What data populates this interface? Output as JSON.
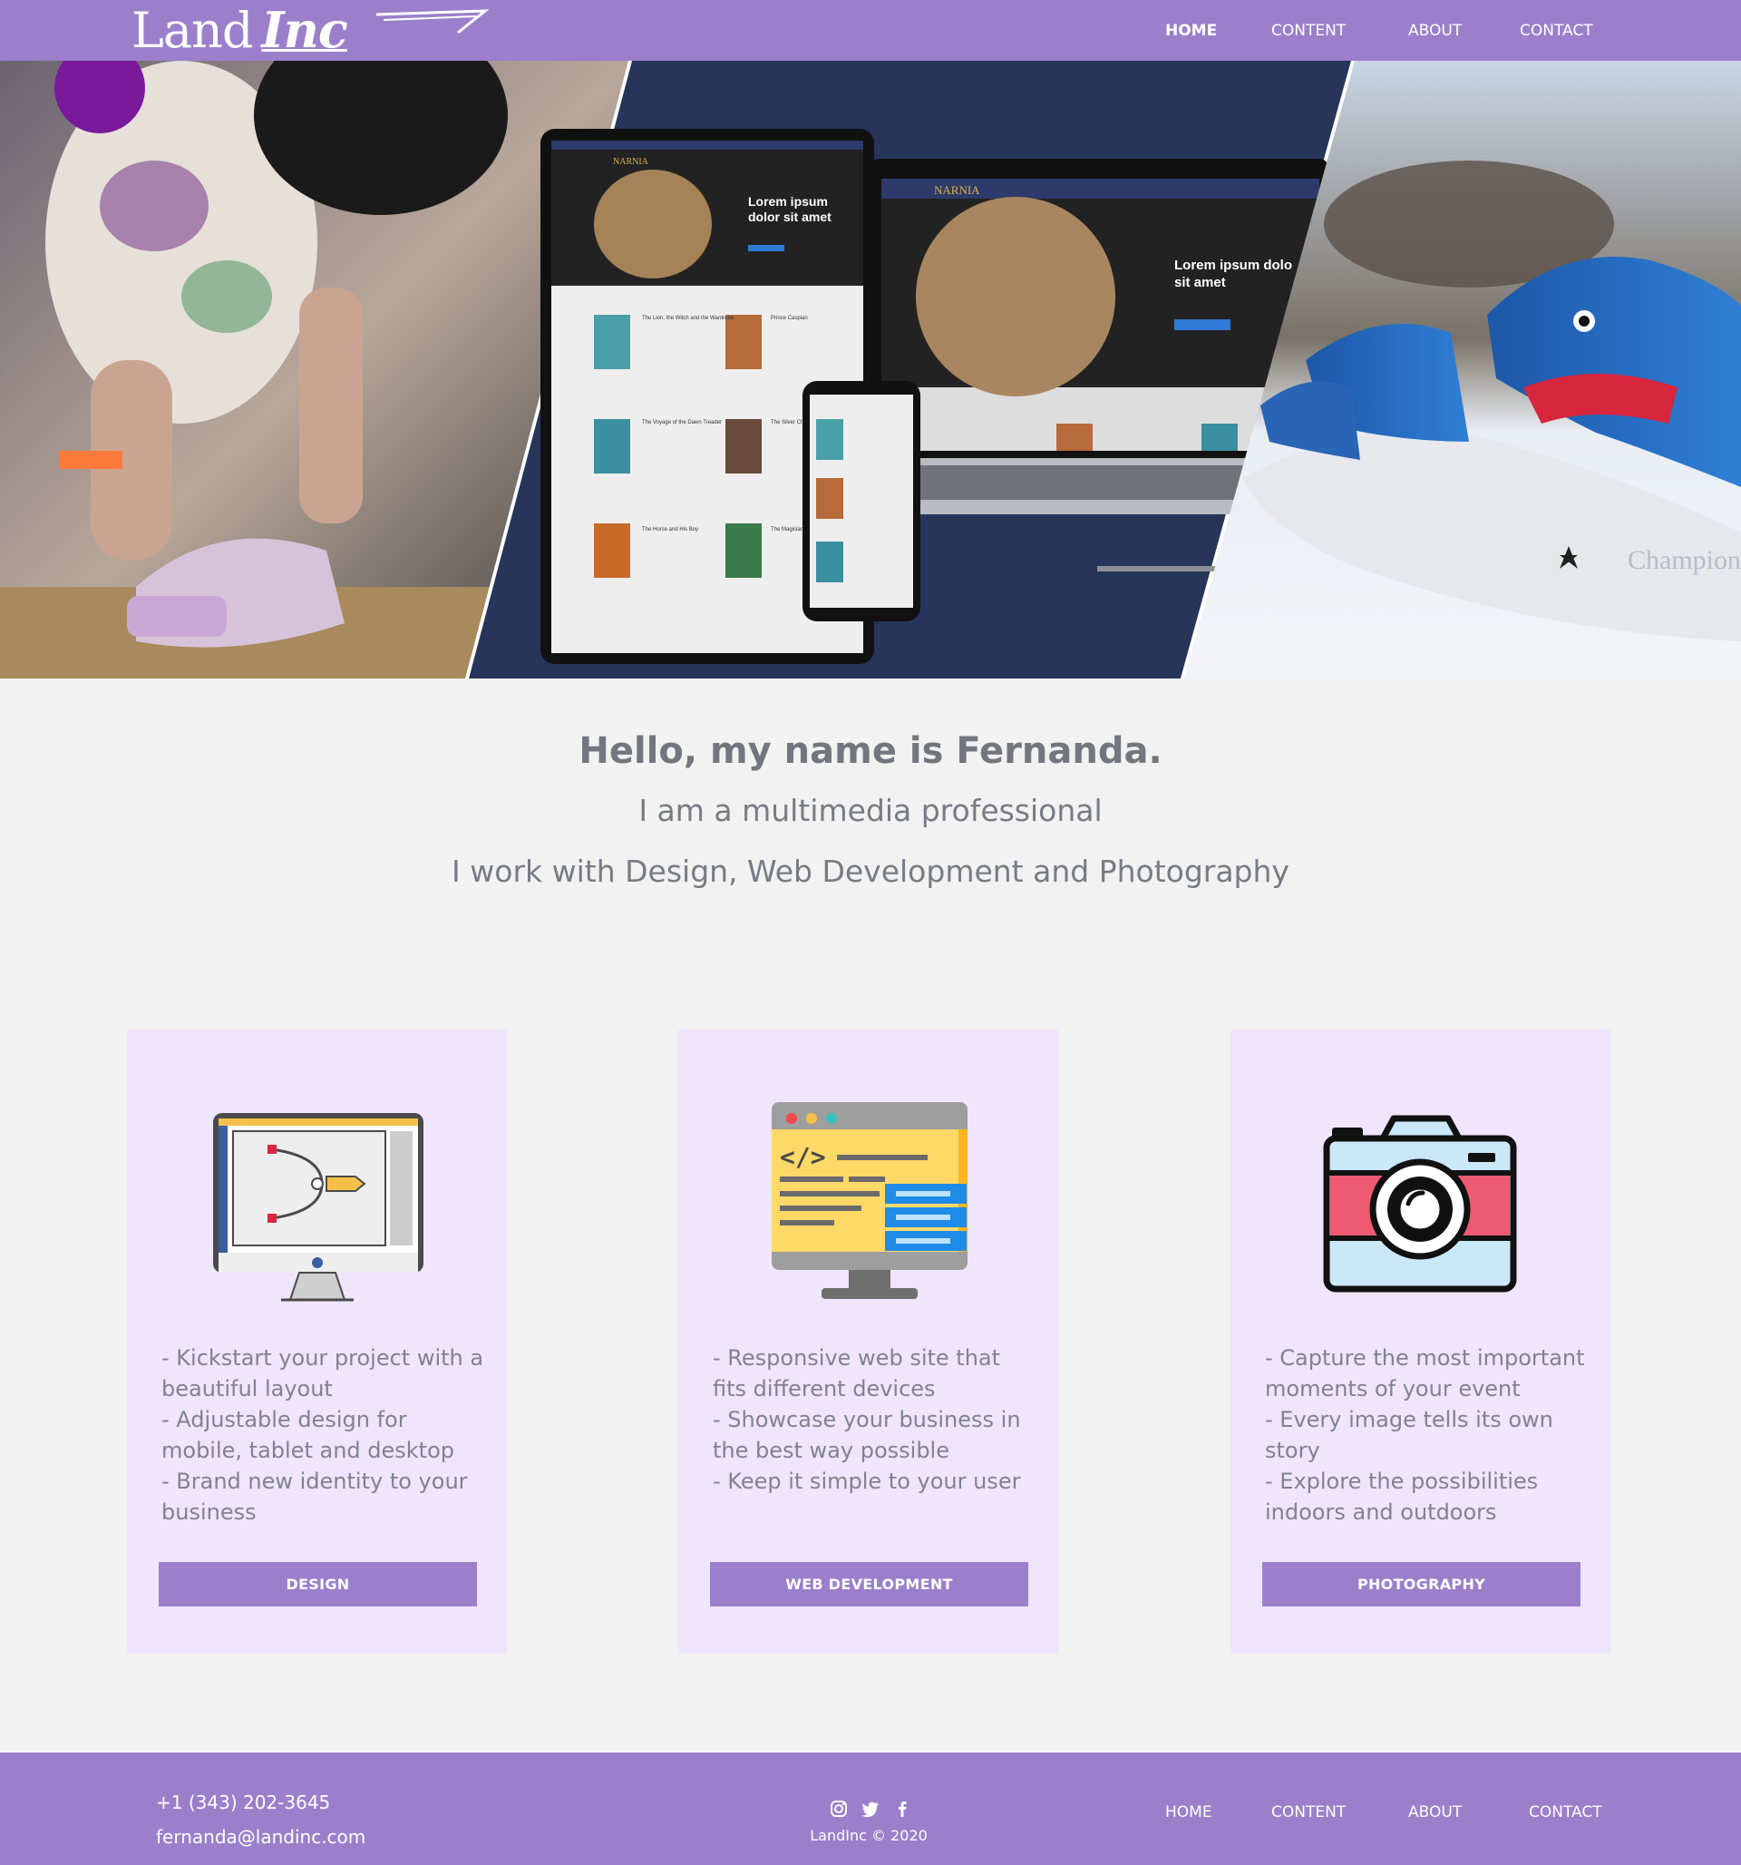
{
  "header": {
    "logo_part1": "Land",
    "logo_part2": "Inc",
    "nav": [
      {
        "label": "HOME",
        "active": true
      },
      {
        "label": "CONTENT",
        "active": false
      },
      {
        "label": "ABOUT",
        "active": false
      },
      {
        "label": "CONTACT",
        "active": false
      }
    ]
  },
  "hero": {
    "mockup_heading_line1": "Lorem ipsum",
    "mockup_heading_line2": "dolor sit amet",
    "mockup_laptop_line1": "Lorem ipsum dolo",
    "mockup_laptop_line2": "sit amet",
    "mockup_logo": "NARNIA",
    "mockup_book1": "The Lion, the Witch and the Wardrobe",
    "mockup_book2": "Prince Caspian",
    "mockup_book3": "The Voyage of the Dawn Treader",
    "mockup_book4": "The Silver Chair",
    "mockup_book5": "The Horse and His Boy",
    "mockup_book6": "The Magician's Nephew",
    "boat_text": "Champion"
  },
  "intro": {
    "title": "Hello, my name is Fernanda.",
    "subtitle": "I am a multimedia professional",
    "line": "I work with Design, Web Development and Photography"
  },
  "cards": [
    {
      "icon": "design-monitor-icon",
      "lines": [
        "- Kickstart your project with a beautiful layout",
        "- Adjustable design for mobile, tablet and desktop",
        "- Brand new identity to your business"
      ],
      "button": "DESIGN"
    },
    {
      "icon": "web-development-icon",
      "lines": [
        "- Responsive web site that fits different devices",
        "- Showcase your business in the best way possible",
        "- Keep it simple to your user"
      ],
      "button": "WEB DEVELOPMENT"
    },
    {
      "icon": "camera-icon",
      "lines": [
        "- Capture the most important moments of your event",
        "- Every image tells its own story",
        "- Explore the possibilities indoors and outdoors"
      ],
      "button": "PHOTOGRAPHY"
    }
  ],
  "footer": {
    "phone": "+1 (343) 202-3645",
    "email": "fernanda@landinc.com",
    "copyright": "LandInc © 2020",
    "social": [
      "instagram-icon",
      "twitter-icon",
      "facebook-icon"
    ],
    "nav": [
      "HOME",
      "CONTENT",
      "ABOUT",
      "CONTACT"
    ]
  },
  "colors": {
    "brand": "#9b7fcb",
    "card_bg": "#efe5fd",
    "page_bg": "#f2f2f2",
    "text": "#75757f"
  }
}
